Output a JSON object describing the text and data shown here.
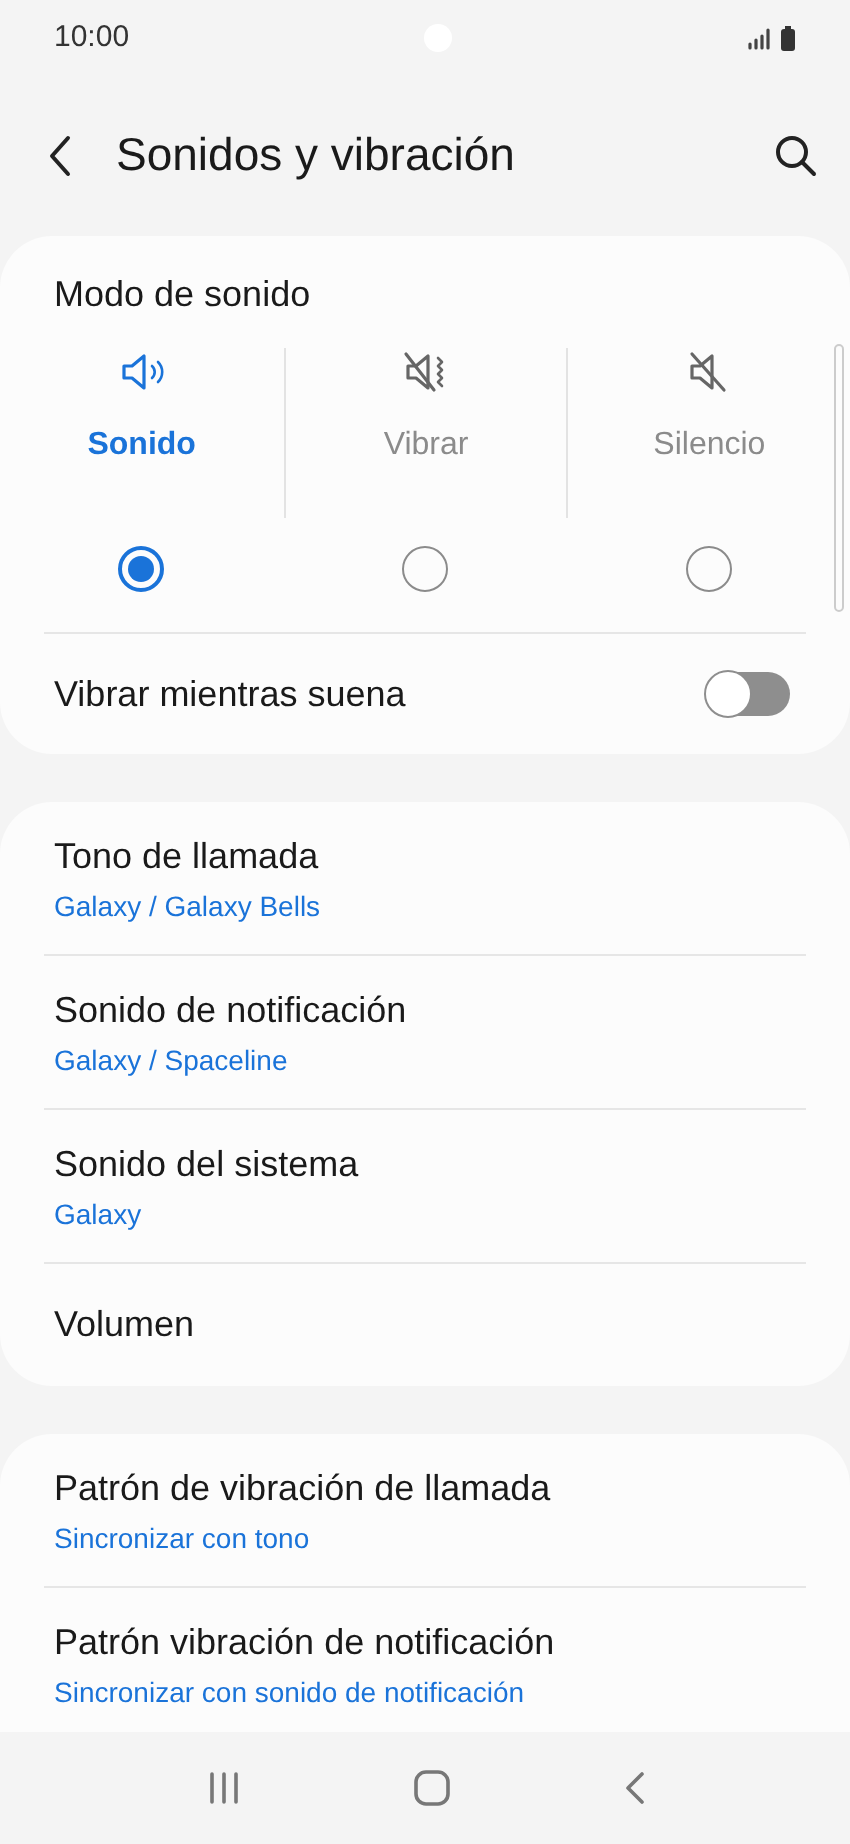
{
  "status_bar": {
    "time": "10:00"
  },
  "header": {
    "title": "Sonidos y vibración"
  },
  "sound_mode": {
    "title": "Modo de sonido",
    "modes": [
      {
        "kind": "sound",
        "label": "Sonido",
        "selected": true
      },
      {
        "kind": "vibrate",
        "label": "Vibrar",
        "selected": false
      },
      {
        "kind": "mute",
        "label": "Silencio",
        "selected": false
      }
    ],
    "vibrate_while_ringing": {
      "label": "Vibrar mientras suena",
      "on": false
    }
  },
  "groups": [
    {
      "items": [
        {
          "title": "Tono de llamada",
          "subtitle": "Galaxy / Galaxy Bells"
        },
        {
          "title": "Sonido de notificación",
          "subtitle": "Galaxy / Spaceline"
        },
        {
          "title": "Sonido del sistema",
          "subtitle": "Galaxy"
        },
        {
          "title": "Volumen"
        }
      ]
    },
    {
      "items": [
        {
          "title": "Patrón de vibración de llamada",
          "subtitle": "Sincronizar con tono"
        },
        {
          "title": "Patrón vibración de notificación",
          "subtitle": "Sincronizar con sonido de notificación"
        }
      ]
    }
  ]
}
